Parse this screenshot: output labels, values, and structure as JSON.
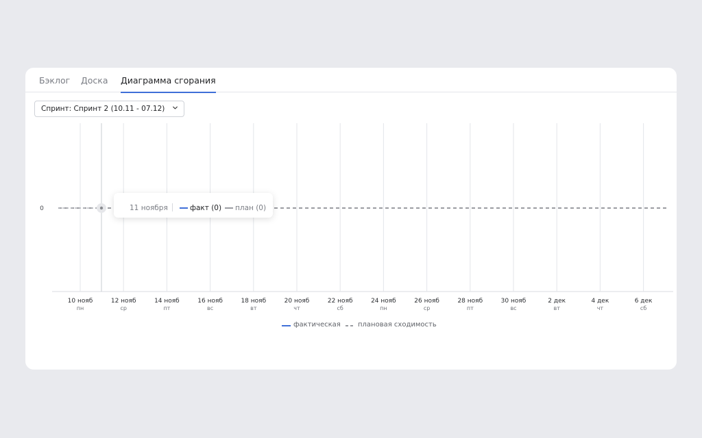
{
  "tabs": [
    {
      "label": "Бэклог",
      "active": false
    },
    {
      "label": "Доска",
      "active": false
    },
    {
      "label": "Диаграмма сгорания",
      "active": true
    }
  ],
  "sprint_select": {
    "value": "Спринт: Спринт 2 (10.11 - 07.12)"
  },
  "chart_data": {
    "type": "line",
    "x_ticks": [
      {
        "date": "10 нояб",
        "dow": "пн"
      },
      {
        "date": "12 нояб",
        "dow": "ср"
      },
      {
        "date": "14 нояб",
        "dow": "пт"
      },
      {
        "date": "16 нояб",
        "dow": "вс"
      },
      {
        "date": "18 нояб",
        "dow": "вт"
      },
      {
        "date": "20 нояб",
        "dow": "чт"
      },
      {
        "date": "22 нояб",
        "dow": "сб"
      },
      {
        "date": "24 нояб",
        "dow": "пн"
      },
      {
        "date": "26 нояб",
        "dow": "ср"
      },
      {
        "date": "28 нояб",
        "dow": "пт"
      },
      {
        "date": "30 нояб",
        "dow": "вс"
      },
      {
        "date": "2 дек",
        "dow": "вт"
      },
      {
        "date": "4 дек",
        "dow": "чт"
      },
      {
        "date": "6 дек",
        "dow": "сб"
      }
    ],
    "y_ticks": [
      "0"
    ],
    "x_range": [
      "10.11",
      "07.12"
    ],
    "series": [
      {
        "name": "фактическая",
        "values": [
          0
        ],
        "color": "#3f6fd8",
        "style": "solid"
      },
      {
        "name": "плановая сходимость",
        "values": [
          0
        ],
        "color": "#9a9ca1",
        "style": "dashed"
      }
    ],
    "grid": true,
    "legend": "bottom-center",
    "hover": {
      "date": "11 ноября",
      "fact": "факт (0)",
      "plan": "план (0)"
    }
  }
}
